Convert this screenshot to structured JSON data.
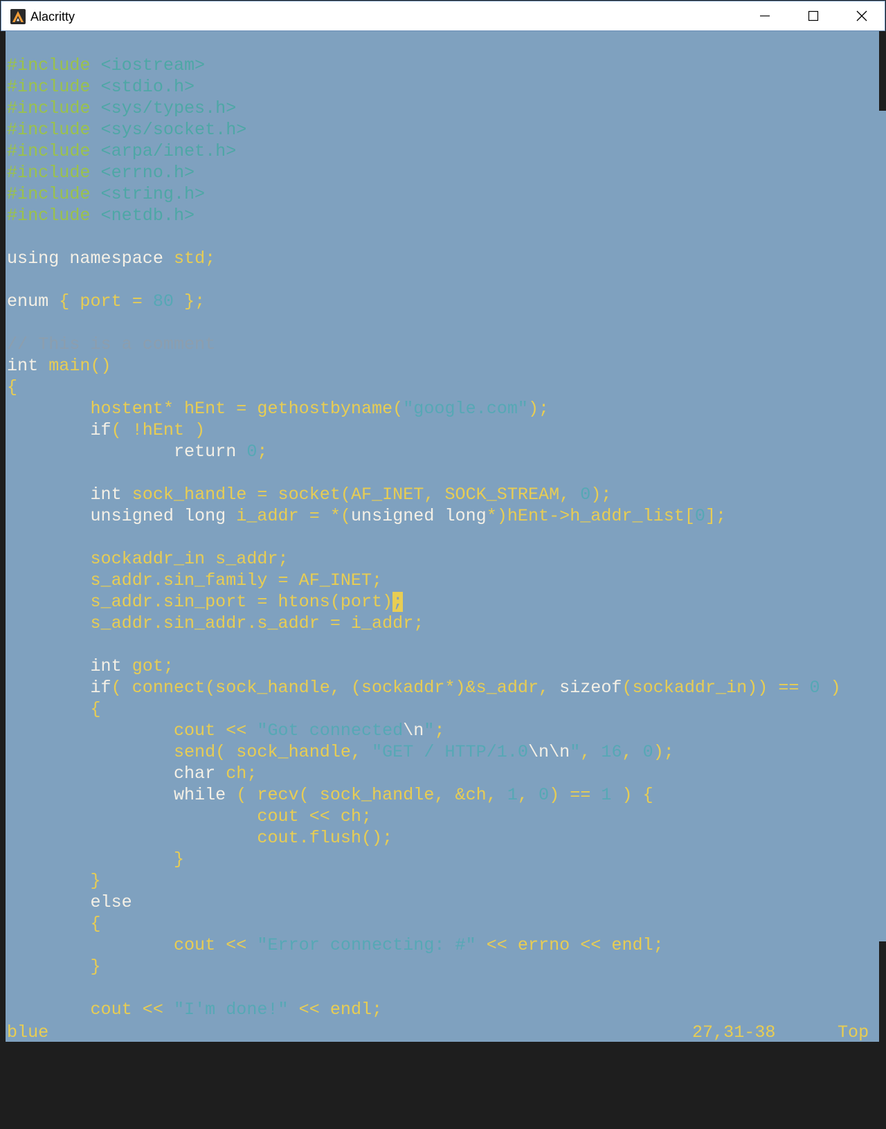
{
  "window": {
    "title": "Alacritty"
  },
  "editor": {
    "lines": [
      [
        {
          "c": "pp",
          "t": "#include "
        },
        {
          "c": "inc",
          "t": "<iostream>"
        }
      ],
      [
        {
          "c": "pp",
          "t": "#include "
        },
        {
          "c": "inc",
          "t": "<stdio.h>"
        }
      ],
      [
        {
          "c": "pp",
          "t": "#include "
        },
        {
          "c": "inc",
          "t": "<sys/types.h>"
        }
      ],
      [
        {
          "c": "pp",
          "t": "#include "
        },
        {
          "c": "inc",
          "t": "<sys/socket.h>"
        }
      ],
      [
        {
          "c": "pp",
          "t": "#include "
        },
        {
          "c": "inc",
          "t": "<arpa/inet.h>"
        }
      ],
      [
        {
          "c": "pp",
          "t": "#include "
        },
        {
          "c": "inc",
          "t": "<errno.h>"
        }
      ],
      [
        {
          "c": "pp",
          "t": "#include "
        },
        {
          "c": "inc",
          "t": "<string.h>"
        }
      ],
      [
        {
          "c": "pp",
          "t": "#include "
        },
        {
          "c": "inc",
          "t": "<netdb.h>"
        }
      ],
      [],
      [
        {
          "c": "kw",
          "t": "using namespace"
        },
        {
          "c": "id",
          "t": " std;"
        }
      ],
      [],
      [
        {
          "c": "kw",
          "t": "enum"
        },
        {
          "c": "id",
          "t": " { port = "
        },
        {
          "c": "num",
          "t": "80"
        },
        {
          "c": "id",
          "t": " };"
        }
      ],
      [],
      [
        {
          "c": "cm",
          "t": "// This is a comment"
        }
      ],
      [
        {
          "c": "kw",
          "t": "int"
        },
        {
          "c": "id",
          "t": " main()"
        }
      ],
      [
        {
          "c": "id",
          "t": "{"
        }
      ],
      [
        {
          "c": "id",
          "t": "        hostent* hEnt = gethostbyname("
        },
        {
          "c": "str",
          "t": "\"google.com\""
        },
        {
          "c": "id",
          "t": ");"
        }
      ],
      [
        {
          "c": "kw",
          "t": "        if"
        },
        {
          "c": "id",
          "t": "( !hEnt )"
        }
      ],
      [
        {
          "c": "kw",
          "t": "                return"
        },
        {
          "c": "id",
          "t": " "
        },
        {
          "c": "num",
          "t": "0"
        },
        {
          "c": "id",
          "t": ";"
        }
      ],
      [],
      [
        {
          "c": "kw",
          "t": "        int"
        },
        {
          "c": "id",
          "t": " sock_handle = socket(AF_INET, SOCK_STREAM, "
        },
        {
          "c": "num",
          "t": "0"
        },
        {
          "c": "id",
          "t": ");"
        }
      ],
      [
        {
          "c": "kw",
          "t": "        unsigned long"
        },
        {
          "c": "id",
          "t": " i_addr = *("
        },
        {
          "c": "kw",
          "t": "unsigned long"
        },
        {
          "c": "id",
          "t": "*)hEnt->h_addr_list["
        },
        {
          "c": "num",
          "t": "0"
        },
        {
          "c": "id",
          "t": "];"
        }
      ],
      [],
      [
        {
          "c": "id",
          "t": "        sockaddr_in s_addr;"
        }
      ],
      [
        {
          "c": "id",
          "t": "        s_addr.sin_family = AF_INET;"
        }
      ],
      [
        {
          "c": "id",
          "t": "        s_addr.sin_port = htons(port)"
        },
        {
          "c": "cursor",
          "t": ";"
        }
      ],
      [
        {
          "c": "id",
          "t": "        s_addr.sin_addr.s_addr = i_addr;"
        }
      ],
      [],
      [
        {
          "c": "kw",
          "t": "        int"
        },
        {
          "c": "id",
          "t": " got;"
        }
      ],
      [
        {
          "c": "kw",
          "t": "        if"
        },
        {
          "c": "id",
          "t": "( connect(sock_handle, (sockaddr*)&s_addr, "
        },
        {
          "c": "kw",
          "t": "sizeof"
        },
        {
          "c": "id",
          "t": "(sockaddr_in)) == "
        },
        {
          "c": "num",
          "t": "0"
        },
        {
          "c": "id",
          "t": " )"
        }
      ],
      [
        {
          "c": "id",
          "t": "        {"
        }
      ],
      [
        {
          "c": "id",
          "t": "                cout << "
        },
        {
          "c": "str",
          "t": "\"Got connected"
        },
        {
          "c": "esc",
          "t": "\\n"
        },
        {
          "c": "str",
          "t": "\""
        },
        {
          "c": "id",
          "t": ";"
        }
      ],
      [
        {
          "c": "id",
          "t": "                send( sock_handle, "
        },
        {
          "c": "str",
          "t": "\"GET / HTTP/1.0"
        },
        {
          "c": "esc",
          "t": "\\n\\n"
        },
        {
          "c": "str",
          "t": "\""
        },
        {
          "c": "id",
          "t": ", "
        },
        {
          "c": "num",
          "t": "16"
        },
        {
          "c": "id",
          "t": ", "
        },
        {
          "c": "num",
          "t": "0"
        },
        {
          "c": "id",
          "t": ");"
        }
      ],
      [
        {
          "c": "kw",
          "t": "                char"
        },
        {
          "c": "id",
          "t": " ch;"
        }
      ],
      [
        {
          "c": "kw",
          "t": "                while"
        },
        {
          "c": "id",
          "t": " ( recv( sock_handle, &ch, "
        },
        {
          "c": "num",
          "t": "1"
        },
        {
          "c": "id",
          "t": ", "
        },
        {
          "c": "num",
          "t": "0"
        },
        {
          "c": "id",
          "t": ") == "
        },
        {
          "c": "num",
          "t": "1"
        },
        {
          "c": "id",
          "t": " ) {"
        }
      ],
      [
        {
          "c": "id",
          "t": "                        cout << ch;"
        }
      ],
      [
        {
          "c": "id",
          "t": "                        cout.flush();"
        }
      ],
      [
        {
          "c": "id",
          "t": "                }"
        }
      ],
      [
        {
          "c": "id",
          "t": "        }"
        }
      ],
      [
        {
          "c": "kw",
          "t": "        else"
        }
      ],
      [
        {
          "c": "id",
          "t": "        {"
        }
      ],
      [
        {
          "c": "id",
          "t": "                cout << "
        },
        {
          "c": "str",
          "t": "\"Error connecting: #\""
        },
        {
          "c": "id",
          "t": " << errno << endl;"
        }
      ],
      [
        {
          "c": "id",
          "t": "        }"
        }
      ],
      [],
      [
        {
          "c": "id",
          "t": "        cout << "
        },
        {
          "c": "str",
          "t": "\"I'm done!\""
        },
        {
          "c": "id",
          "t": " << endl;"
        }
      ]
    ]
  },
  "statusline": {
    "mode": "blue",
    "cursor_position": "27,31-38",
    "scroll_position": "Top"
  },
  "colors": {
    "background": "#7fa1bf",
    "identifier": "#e8cd53",
    "keyword": "#f4f0e6",
    "preprocessor": "#9bc24b",
    "string": "#56a8b5",
    "comment": "#8c9eae"
  },
  "icons": {
    "app": "alacritty-logo-icon",
    "minimize": "minimize-icon",
    "maximize": "maximize-icon",
    "close": "close-icon"
  }
}
